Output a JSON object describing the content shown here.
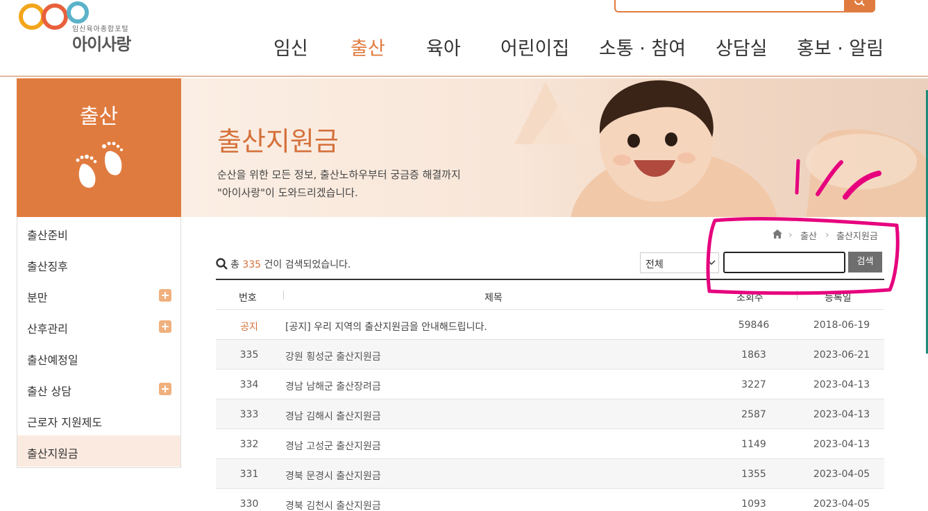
{
  "logo": {
    "small_text": "임신육아종합포털",
    "main_text": "아이사랑"
  },
  "gnb": [
    {
      "label": "임신"
    },
    {
      "label": "출산"
    },
    {
      "label": "육아"
    },
    {
      "label": "어린이집"
    },
    {
      "label": "소통 · 참여"
    },
    {
      "label": "상담실"
    },
    {
      "label": "홍보 · 알림"
    }
  ],
  "side_banner": {
    "title": "출산",
    "icon": "baby-feet-icon"
  },
  "hero": {
    "title": "출산지원금",
    "desc1": "순산을 위한 모든 정보, 출산노하우부터 궁금증 해결까지",
    "desc2": "\"아이사랑\"이 도와드리겠습니다."
  },
  "side_menu": [
    {
      "label": "출산준비",
      "expand": false
    },
    {
      "label": "출산징후",
      "expand": false
    },
    {
      "label": "분만",
      "expand": true
    },
    {
      "label": "산후관리",
      "expand": true
    },
    {
      "label": "출산예정일",
      "expand": false
    },
    {
      "label": "출산 상담",
      "expand": true
    },
    {
      "label": "근로자 지원제도",
      "expand": false
    },
    {
      "label": "출산지원금",
      "expand": false
    }
  ],
  "breadcrumb": {
    "level1": "출산",
    "level2": "출산지원금"
  },
  "search": {
    "count_prefix": "총",
    "count": "335",
    "count_suffix": "건이 검색되었습니다.",
    "select_value": "전체",
    "input_value": "",
    "button_label": "검색"
  },
  "table": {
    "headers": {
      "no": "번호",
      "title": "제목",
      "views": "조회수",
      "date": "등록일"
    },
    "rows": [
      {
        "no": "공지",
        "title": "[공지] 우리 지역의 출산지원금을 안내해드립니다.",
        "views": "59846",
        "date": "2018-06-19"
      },
      {
        "no": "335",
        "title": "강원 횡성군 출산지원금",
        "views": "1863",
        "date": "2023-06-21"
      },
      {
        "no": "334",
        "title": "경남 남해군 출산장려금",
        "views": "3227",
        "date": "2023-04-13"
      },
      {
        "no": "333",
        "title": "경남 김해시 출산지원금",
        "views": "2587",
        "date": "2023-04-13"
      },
      {
        "no": "332",
        "title": "경남 고성군 출산지원금",
        "views": "1149",
        "date": "2023-04-13"
      },
      {
        "no": "331",
        "title": "경북 문경시 출산지원금",
        "views": "1355",
        "date": "2023-04-05"
      },
      {
        "no": "330",
        "title": "경북 김천시 출산지원금",
        "views": "1093",
        "date": "2023-04-05"
      }
    ]
  },
  "colors": {
    "accent": "#e07b3f",
    "annotation": "#e6007e",
    "active_bg": "#fbeae0"
  }
}
